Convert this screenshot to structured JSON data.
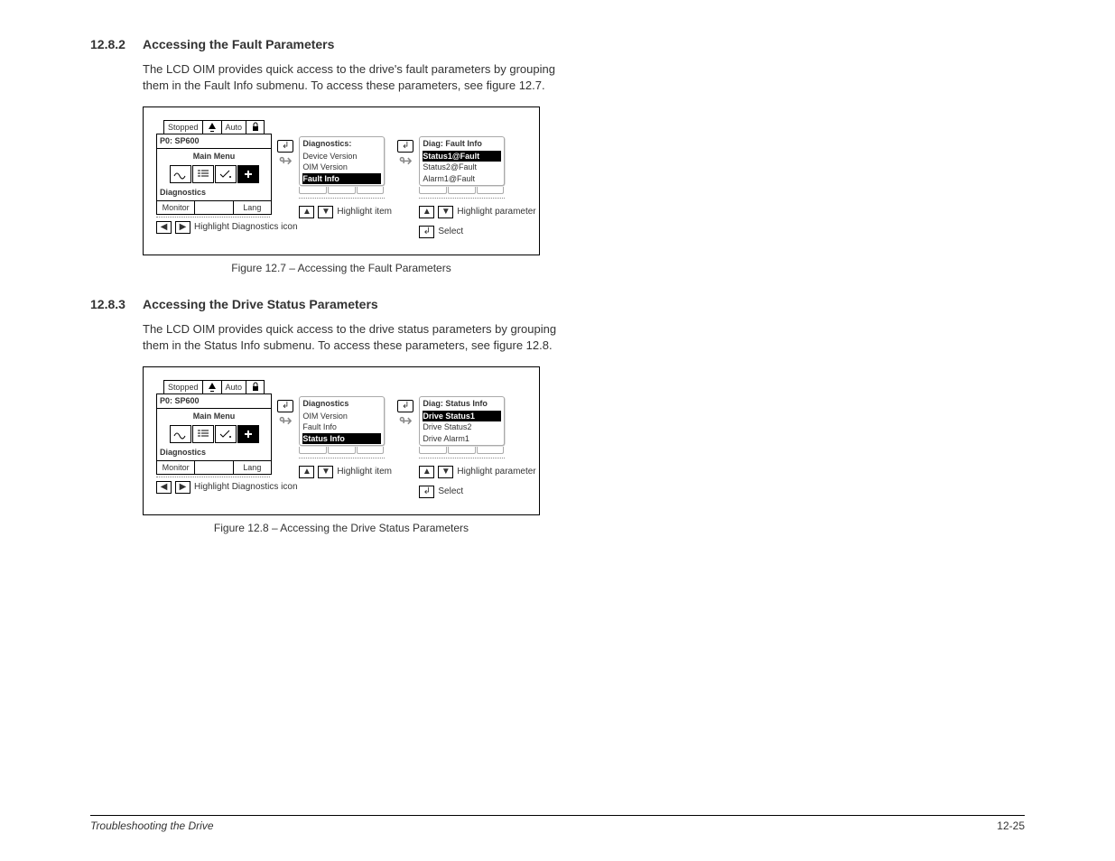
{
  "section1": {
    "num": "12.8.2",
    "title": "Accessing the Fault Parameters",
    "body": "The LCD OIM provides quick access to the drive's fault parameters by grouping them in the Fault Info submenu.  To access these parameters, see figure 12.7.",
    "caption": "Figure 12.7 – Accessing the Fault Parameters"
  },
  "section2": {
    "num": "12.8.3",
    "title": "Accessing the Drive Status Parameters",
    "body": "The LCD OIM provides quick access to the drive status parameters by grouping them in the Status Info submenu. To access these parameters, see figure 12.8.",
    "caption": "Figure 12.8 – Accessing the Drive Status Parameters"
  },
  "oim": {
    "stopped": "Stopped",
    "auto": "Auto",
    "p0": "P0: SP600",
    "mainmenu": "Main Menu",
    "diagnostics": "Diagnostics",
    "monitor": "Monitor",
    "lang": "Lang",
    "legend_diag": "Highlight Diagnostics icon"
  },
  "fig1": {
    "panel2_title": "Diagnostics:",
    "panel2_l1": "Device Version",
    "panel2_l2": "OIM Version",
    "panel2_l3": "Fault Info",
    "panel3_title": "Diag: Fault Info",
    "panel3_l1": "Status1@Fault",
    "panel3_l2": "Status2@Fault",
    "panel3_l3": "Alarm1@Fault",
    "legend_item": "Highlight item",
    "legend_param": "Highlight parameter",
    "legend_select": "Select"
  },
  "fig2": {
    "panel2_title": "Diagnostics",
    "panel2_l1": "OIM Version",
    "panel2_l2": "Fault Info",
    "panel2_l3": "Status Info",
    "panel3_title": "Diag: Status Info",
    "panel3_l1": "Drive Status1",
    "panel3_l2": "Drive Status2",
    "panel3_l3": "Drive Alarm1",
    "legend_item": "Highlight item",
    "legend_param": "Highlight parameter",
    "legend_select": "Select"
  },
  "footer": {
    "left": "Troubleshooting the Drive",
    "right": "12-25"
  }
}
